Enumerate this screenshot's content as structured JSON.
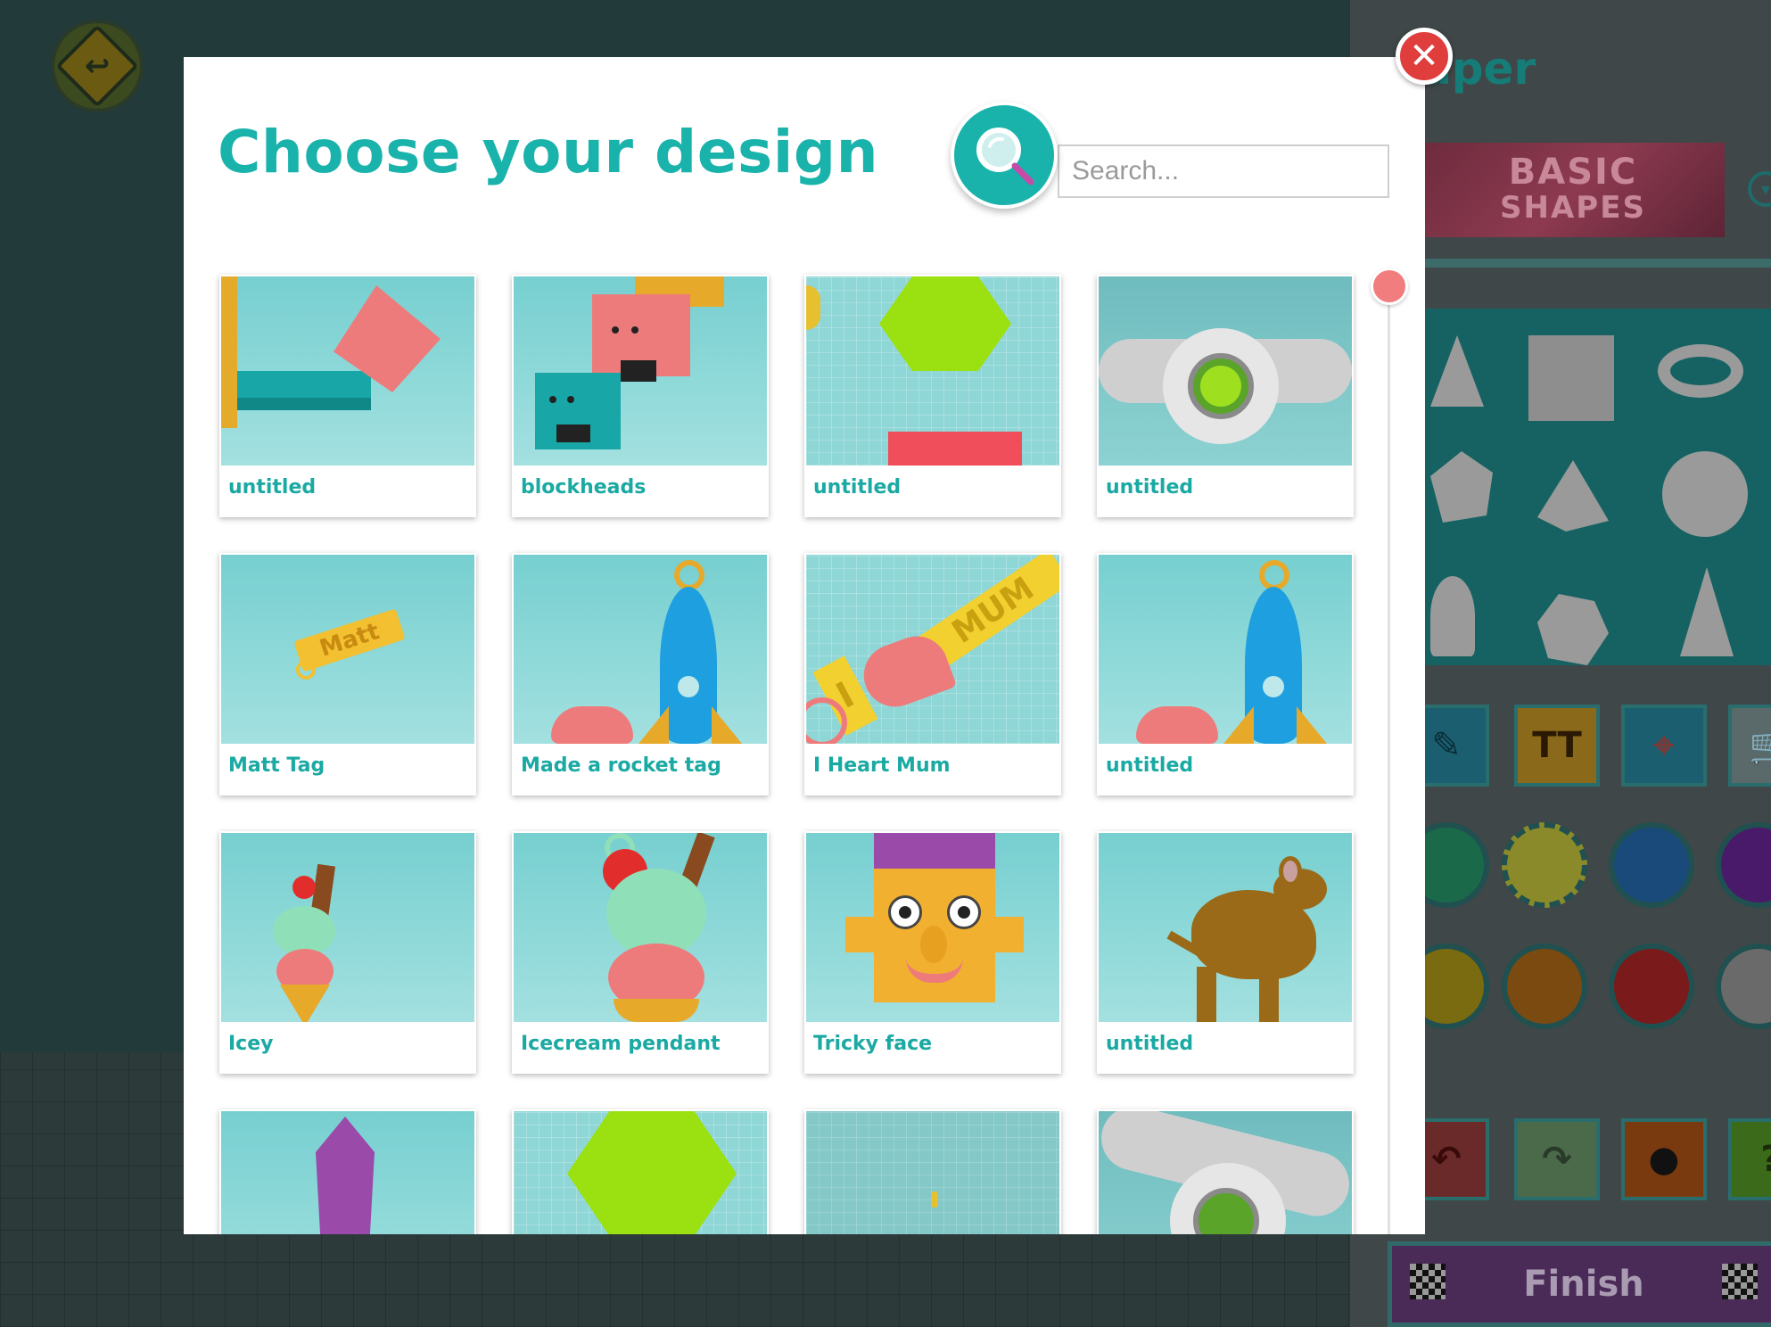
{
  "background": {
    "side_title": "aper",
    "banner_line1": "BASIC",
    "banner_line2": "SHAPES",
    "finish_label": "Finish",
    "text_tool_label": "TT"
  },
  "modal": {
    "title": "Choose your design",
    "search": {
      "placeholder": "Search..."
    },
    "close_label": "✕",
    "designs": [
      {
        "name": "untitled"
      },
      {
        "name": "blockheads"
      },
      {
        "name": "untitled"
      },
      {
        "name": "untitled"
      },
      {
        "name": "Matt Tag"
      },
      {
        "name": "Made a rocket tag"
      },
      {
        "name": "I Heart Mum"
      },
      {
        "name": "untitled"
      },
      {
        "name": "Icey"
      },
      {
        "name": "Icecream pendant"
      },
      {
        "name": "Tricky face"
      },
      {
        "name": "untitled"
      },
      {
        "name": ""
      },
      {
        "name": ""
      },
      {
        "name": ""
      },
      {
        "name": ""
      }
    ]
  },
  "colors": {
    "accent": "#1ab3ac",
    "close": "#e03d3d",
    "scroll_thumb": "#f17d7e"
  }
}
